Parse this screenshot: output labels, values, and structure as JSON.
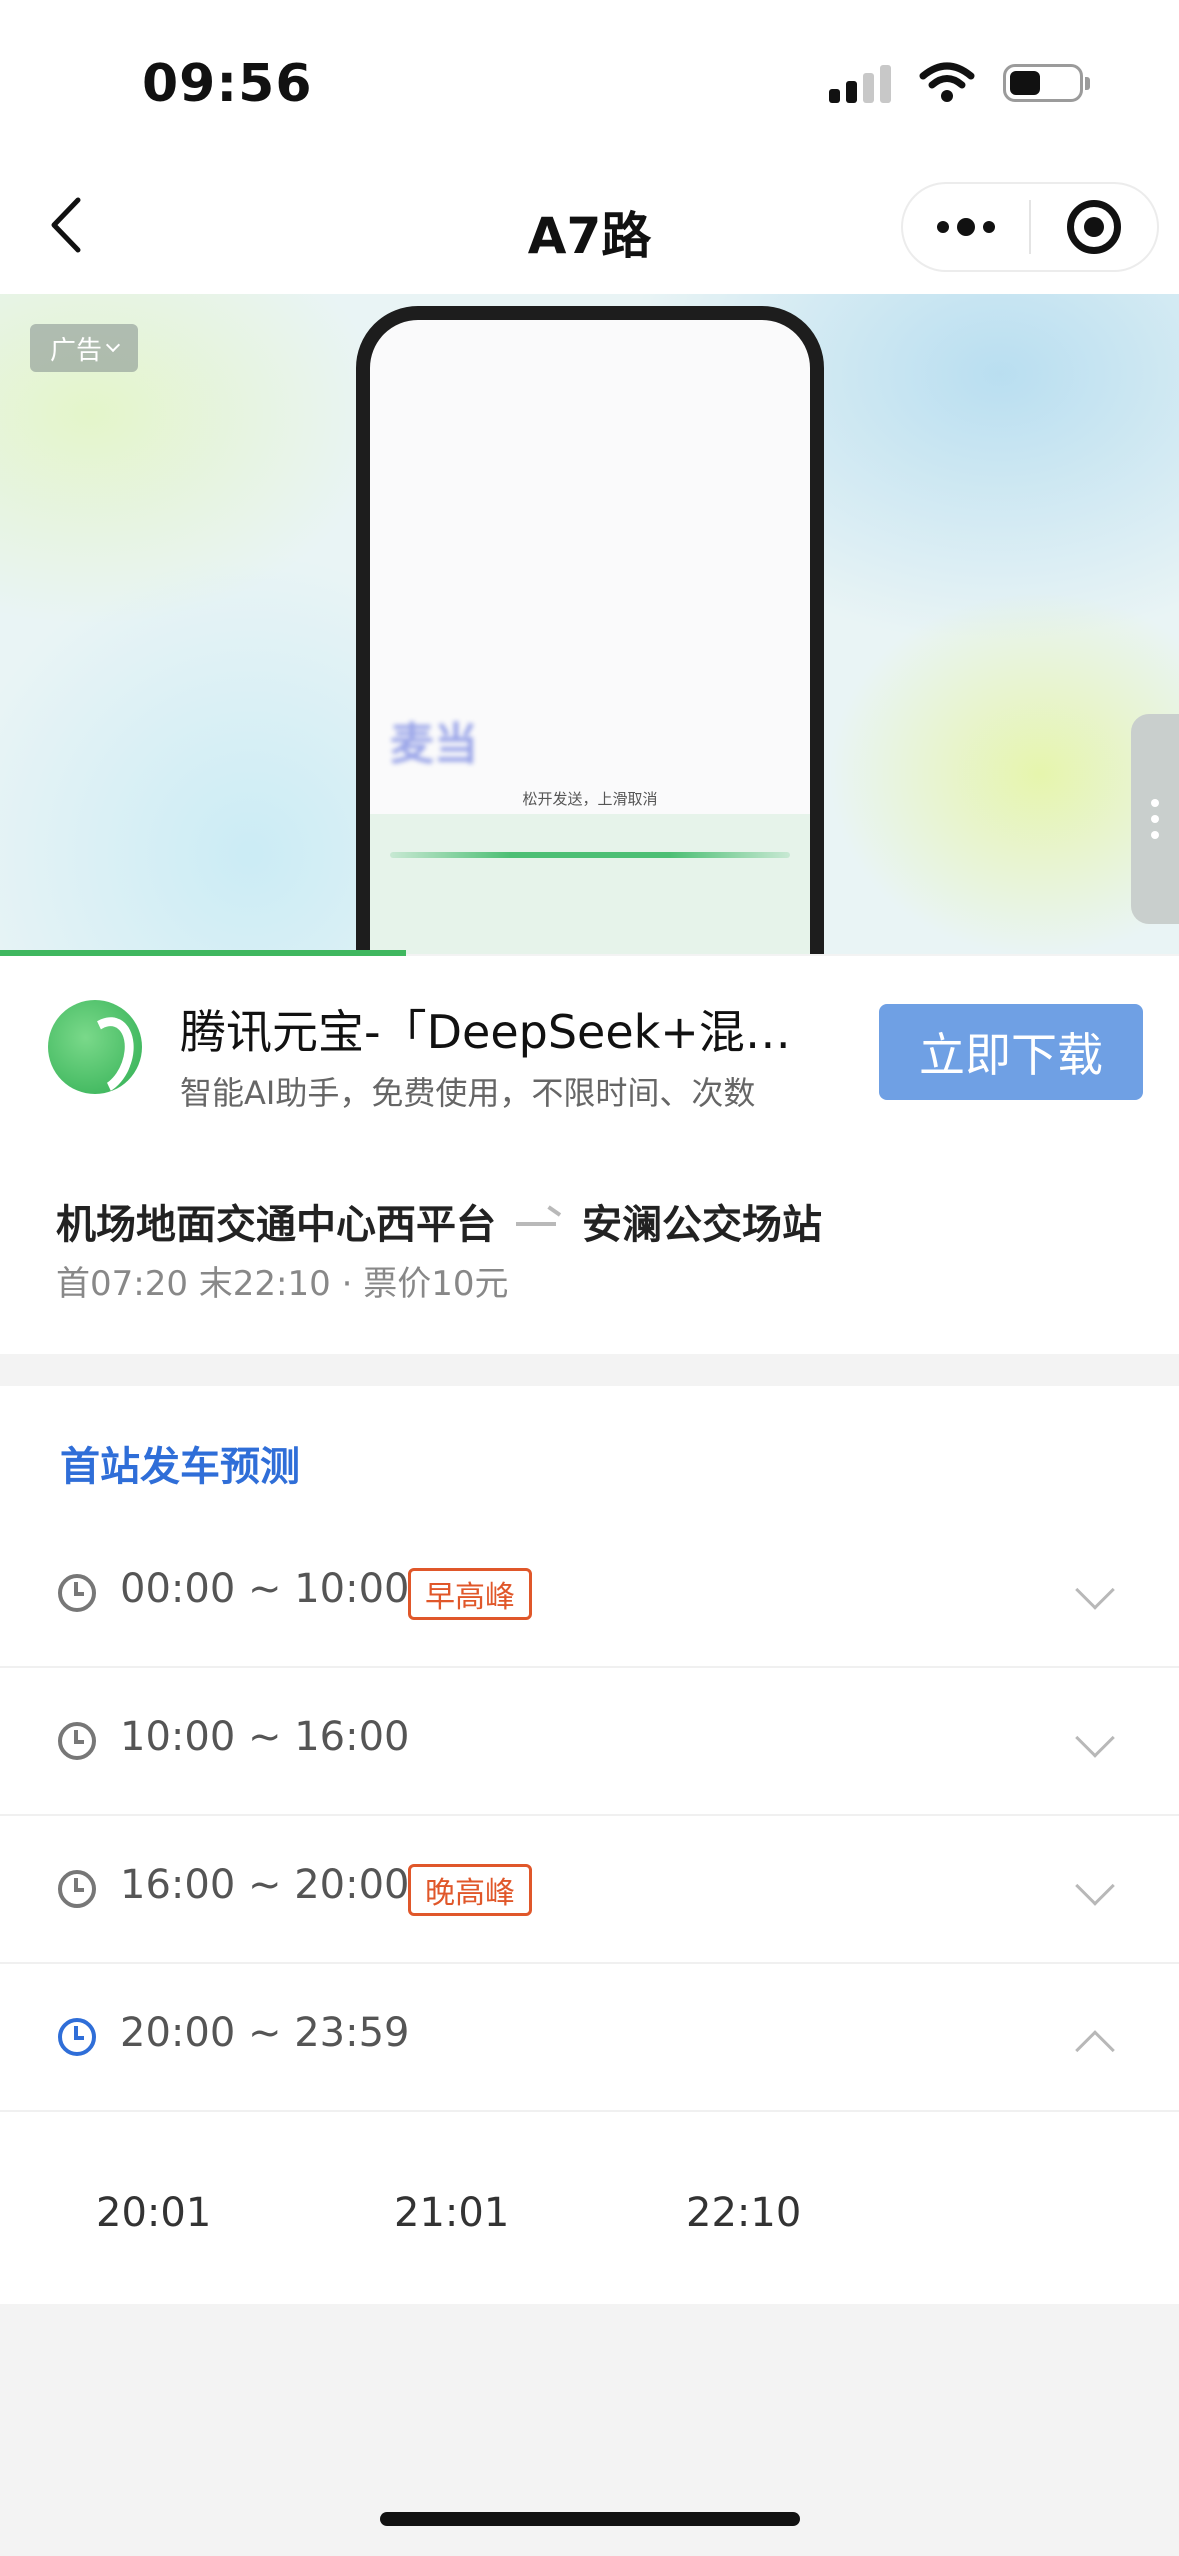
{
  "status_bar": {
    "time": "09:56"
  },
  "nav": {
    "title": "A7路"
  },
  "ad": {
    "label": "广告",
    "phone_hint": "松开发送，上滑取消",
    "phone_blur_text": "麦当"
  },
  "app_card": {
    "title": "腾讯元宝-「DeepSeek+混元」双模型",
    "description": "智能AI助手，免费使用，不限时间、次数",
    "download_label": "立即下载"
  },
  "route": {
    "from": "机场地面交通中心西平台",
    "to": "安澜公交场站",
    "meta": "首07:20 末22:10 · 票价10元"
  },
  "prediction": {
    "title": "首站发车预测",
    "slots": [
      {
        "range": "00:00 ~ 10:00",
        "tag": "早高峰",
        "expanded": false
      },
      {
        "range": "10:00 ~ 16:00",
        "tag": "",
        "expanded": false
      },
      {
        "range": "16:00 ~ 20:00",
        "tag": "晚高峰",
        "expanded": false
      },
      {
        "range": "20:00 ~ 23:59",
        "tag": "",
        "expanded": true
      }
    ],
    "departures": [
      "20:01",
      "21:01",
      "22:10"
    ]
  },
  "colors": {
    "accent_blue": "#2f6ed8",
    "peak_orange": "#e0572a",
    "download_button": "#6fa0e4",
    "ad_progress_green": "#3fb75f"
  },
  "icons": [
    "back-chevron-icon",
    "more-dots-icon",
    "target-icon",
    "clock-icon",
    "chevron-down-icon",
    "chevron-up-icon"
  ]
}
